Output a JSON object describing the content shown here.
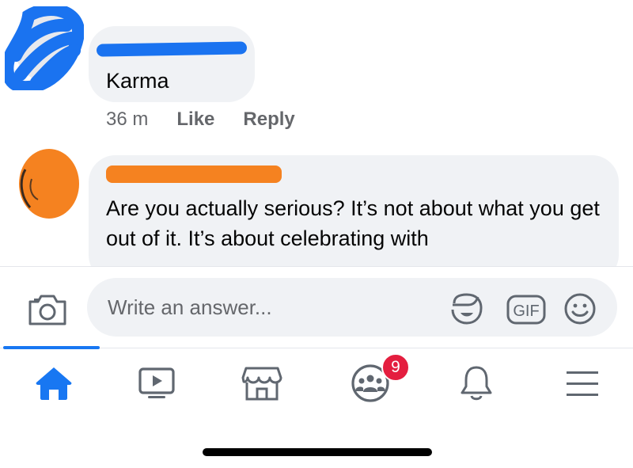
{
  "comments": [
    {
      "name_visible_fragment": "",
      "text": "Karma",
      "time": "36 m",
      "like_label": "Like",
      "reply_label": "Reply"
    },
    {
      "name_visible_fragment": "",
      "text": "Are you actually serious? It’s not about what you get out of it. It’s about celebrating with"
    }
  ],
  "composer": {
    "placeholder": "Write an answer...",
    "gif_label": "GIF"
  },
  "tabbar": {
    "items": [
      {
        "id": "home",
        "icon": "home-icon",
        "active": true
      },
      {
        "id": "watch",
        "icon": "video-icon"
      },
      {
        "id": "marketplace",
        "icon": "marketplace-icon"
      },
      {
        "id": "groups",
        "icon": "groups-icon",
        "badge": "9"
      },
      {
        "id": "notifications",
        "icon": "bell-icon"
      },
      {
        "id": "menu",
        "icon": "menu-icon"
      }
    ]
  },
  "colors": {
    "accent": "#1877f2",
    "badge": "#e41e3f",
    "bubble": "#f0f2f5",
    "redact_1": "#1a73f0",
    "redact_2": "#f58220"
  }
}
